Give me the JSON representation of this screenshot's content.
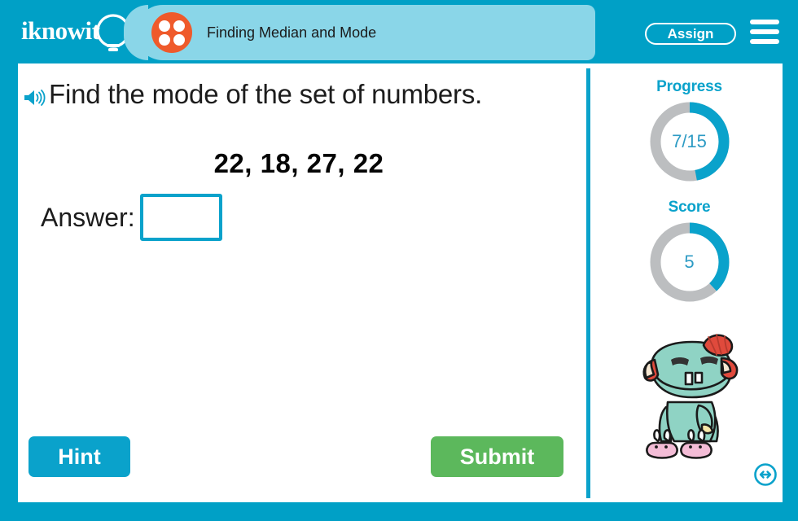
{
  "brand": {
    "logo_text": "iknowit",
    "logo_icon": "lightbulb-icon"
  },
  "header": {
    "topic_title": "Finding Median and Mode",
    "topic_icon": "four-dots-circle-icon",
    "assign_label": "Assign",
    "menu_icon": "hamburger-menu-icon",
    "bar_color": "#00a0c6",
    "tab_color": "#8ad6e8",
    "dots_color": "#ef5a2b"
  },
  "question": {
    "speaker_icon": "speaker-audio-icon",
    "prompt": "Find the mode of the set of numbers.",
    "numbers": "22, 18, 27, 22",
    "answer_label": "Answer:",
    "answer_value": "",
    "answer_placeholder": ""
  },
  "actions": {
    "hint_label": "Hint",
    "hint_color": "#0aa2cb",
    "submit_label": "Submit",
    "submit_color": "#5cb85c"
  },
  "sidebar": {
    "progress": {
      "label": "Progress",
      "value": "7/15",
      "current": 7,
      "total": 15,
      "percent": 47,
      "arc_color": "#0aa2cb",
      "track_color": "#bcbec0"
    },
    "score": {
      "label": "Score",
      "value": "5",
      "current": 5,
      "percent": 38,
      "arc_color": "#0aa2cb",
      "track_color": "#bcbec0"
    },
    "mascot_icon": "monster-mascot-character",
    "resize_icon": "resize-horizontal-arrows-icon"
  }
}
